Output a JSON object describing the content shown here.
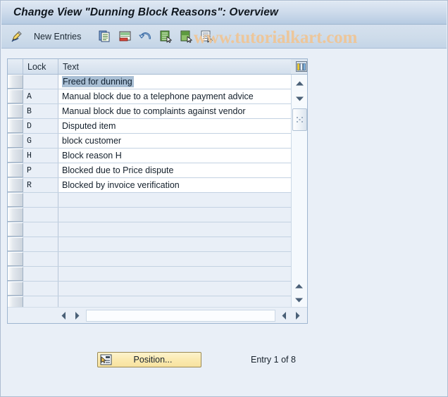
{
  "window": {
    "title": "Change View \"Dunning Block Reasons\": Overview"
  },
  "watermark": {
    "text": "www.tutorialkart.com",
    "color": "#edc69a"
  },
  "toolbar": {
    "items": [
      {
        "name": "change-pencil-icon",
        "label": "",
        "icon": "pencil-ruler-icon"
      },
      {
        "name": "new-entries-button",
        "label": "New Entries",
        "icon": ""
      },
      {
        "name": "copy-as-button",
        "label": "",
        "icon": "copy-icon"
      },
      {
        "name": "delete-button",
        "label": "",
        "icon": "delete-row-icon"
      },
      {
        "name": "undo-button",
        "label": "",
        "icon": "undo-arrow-icon"
      },
      {
        "name": "select-all-button",
        "label": "",
        "icon": "select-all-icon"
      },
      {
        "name": "deselect-all-button",
        "label": "",
        "icon": "deselect-all-icon"
      },
      {
        "name": "variable-list-button",
        "label": "",
        "icon": "list-select-icon"
      }
    ]
  },
  "table": {
    "columns": [
      {
        "key": "rowsel",
        "label": ""
      },
      {
        "key": "lock",
        "label": "Lock"
      },
      {
        "key": "text",
        "label": "Text"
      }
    ],
    "config_icon": "column-settings-icon",
    "rows": [
      {
        "lock": "",
        "text": "Freed for dunning",
        "selected": true
      },
      {
        "lock": "A",
        "text": "Manual block due to a telephone payment advice",
        "selected": false
      },
      {
        "lock": "B",
        "text": "Manual block due to complaints against vendor",
        "selected": false
      },
      {
        "lock": "D",
        "text": "Disputed item",
        "selected": false
      },
      {
        "lock": "G",
        "text": "block customer",
        "selected": false
      },
      {
        "lock": "H",
        "text": "Block reason H",
        "selected": false
      },
      {
        "lock": "P",
        "text": "Blocked due to Price dispute",
        "selected": false
      },
      {
        "lock": "R",
        "text": "Blocked by invoice verification",
        "selected": false
      }
    ],
    "empty_row_count": 8
  },
  "scrollbars": {
    "vertical": {
      "up_icon": "scroll-up-icon",
      "down_icon": "scroll-down-icon",
      "thumb_icon": "scroll-thumb-grip"
    },
    "horizontal": {
      "left_icon": "scroll-left-icon",
      "right_icon": "scroll-right-icon"
    }
  },
  "footer": {
    "position_button_label": "Position...",
    "position_button_icon": "position-icon",
    "entry_status": "Entry 1 of 8"
  }
}
